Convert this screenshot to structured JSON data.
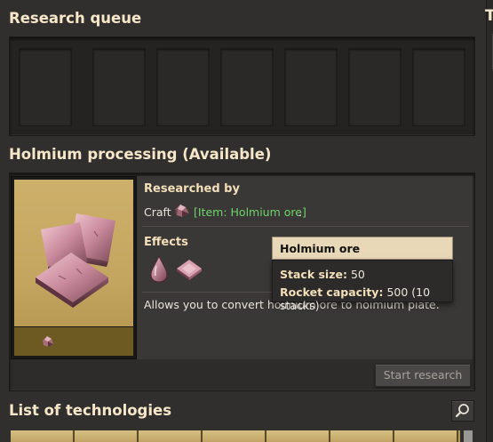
{
  "research_queue": {
    "heading": "Research queue",
    "slot_count": 7
  },
  "technology": {
    "heading": "Holmium processing (Available)",
    "researched_by_label": "Researched by",
    "craft_prefix": "Craft",
    "craft_item": "[Item: Holmium ore]",
    "craft_suffix": ".",
    "effects_label": "Effects",
    "description": "Allows you to convert holmium ore to holmium plate.",
    "start_button": "Start research",
    "effect_icons": [
      "holmium-solution-icon",
      "holmium-plate-icon"
    ]
  },
  "tooltip": {
    "title": "Holmium ore",
    "stack_size_label": "Stack size:",
    "stack_size_value": "50",
    "rocket_capacity_label": "Rocket capacity:",
    "rocket_capacity_value": "500 (10 stacks)"
  },
  "tech_list": {
    "heading": "List of technologies"
  },
  "right_panel": {
    "title_glyph": "T"
  },
  "colors": {
    "heading": "#f6e7c9",
    "item_link": "#6fd46b",
    "card_art": "#cdb06b"
  }
}
